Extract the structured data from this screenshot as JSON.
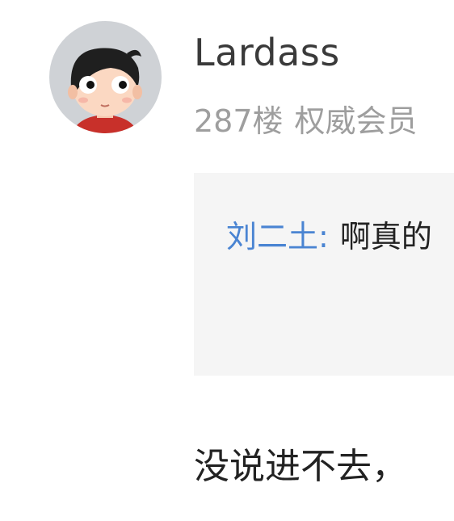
{
  "post": {
    "username": "Lardass",
    "floor": "287楼",
    "role": "权威会员",
    "quote": {
      "author": "刘二土:",
      "text": "啊真的"
    },
    "body": "没说进不去，"
  },
  "colors": {
    "username": "#3a3a3a",
    "meta": "#9e9e9e",
    "quote_author": "#4a84d2",
    "quote_bg": "#f5f5f5",
    "body": "#222222"
  },
  "icons": {
    "avatar": "cartoon-boy-avatar"
  }
}
